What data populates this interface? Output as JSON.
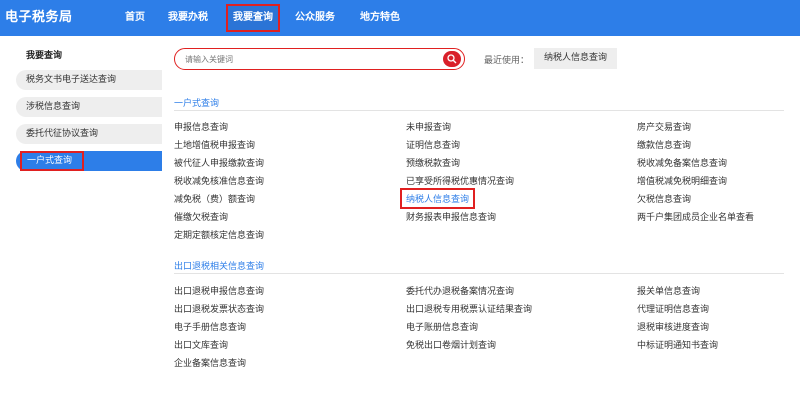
{
  "header": {
    "brand": "电子税务局",
    "nav": [
      "首页",
      "我要办税",
      "我要查询",
      "公众服务",
      "地方特色"
    ]
  },
  "sidebar": {
    "title": "我要查询",
    "items": [
      "税务文书电子送达查询",
      "涉税信息查询",
      "委托代征协议查询",
      "一户式查询"
    ]
  },
  "search": {
    "placeholder": "请输入关键词",
    "recent_label": "最近使用：",
    "recent_item": "纳税人信息查询"
  },
  "sections": [
    {
      "title": "一户式查询",
      "col1": [
        "申报信息查询",
        "土地增值税申报查询",
        "被代征人申报缴款查询",
        "税收减免核准信息查询",
        "减免税（费）额查询",
        "催缴欠税查询",
        "定期定额核定信息查询"
      ],
      "col2": [
        "未申报查询",
        "证明信息查询",
        "预缴税款查询",
        "已享受所得税优惠情况查询",
        "纳税人信息查询",
        "财务报表申报信息查询"
      ],
      "col3": [
        "房产交易查询",
        "缴款信息查询",
        "税收减免备案信息查询",
        "增值税减免税明细查询",
        "欠税信息查询",
        "两千户集团成员企业名单查看"
      ]
    },
    {
      "title": "出口退税相关信息查询",
      "col1": [
        "出口退税申报信息查询",
        "出口退税发票状态查询",
        "电子手册信息查询",
        "出口文库查询",
        "企业备案信息查询"
      ],
      "col2": [
        "委托代办退税备案情况查询",
        "出口退税专用税票认证结果查询",
        "电子账册信息查询",
        "免税出口卷烟计划查询"
      ],
      "col3": [
        "报关单信息查询",
        "代理证明信息查询",
        "退税审核进度查询",
        "中标证明通知书查询"
      ]
    }
  ],
  "colors": {
    "primary": "#2d7ee8",
    "highlight_border": "#e02020"
  }
}
